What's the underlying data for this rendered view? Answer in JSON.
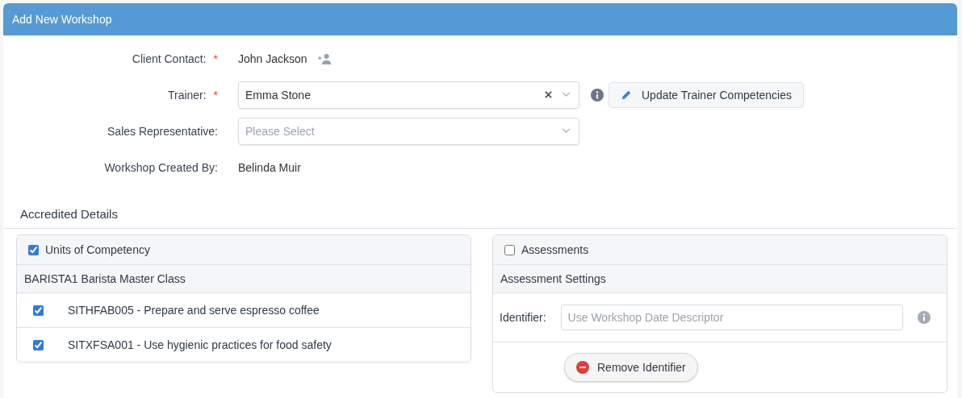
{
  "window": {
    "title": "Add New Workshop"
  },
  "fields": [
    {
      "kind": "text",
      "label": "Client Contact:",
      "required_mark": "*",
      "value": "John Jackson",
      "add_person": true
    },
    {
      "kind": "select",
      "label": "Trainer:",
      "required_mark": "*",
      "value": "Emma Stone",
      "clearable": true,
      "info": true,
      "action": "Update Trainer Competencies"
    },
    {
      "kind": "select",
      "label": "Sales Representative:",
      "placeholder": "Please Select"
    },
    {
      "kind": "text",
      "label": "Workshop Created By:",
      "value": "Belinda Muir"
    }
  ],
  "section_title": "Accredited Details",
  "units": {
    "label": "Units of Competency",
    "checked": true,
    "group": "BARISTA1 Barista Master Class",
    "items": [
      {
        "label": "SITHFAB005 - Prepare and serve espresso coffee",
        "checked": true
      },
      {
        "label": "SITXFSA001 - Use hygienic practices for food safety",
        "checked": true
      }
    ]
  },
  "assessments": {
    "label": "Assessments",
    "checked": false,
    "settings_title": "Assessment Settings",
    "identifier_label": "Identifier:",
    "identifier_placeholder": "Use Workshop Date Descriptor",
    "remove_button": "Remove Identifier"
  }
}
